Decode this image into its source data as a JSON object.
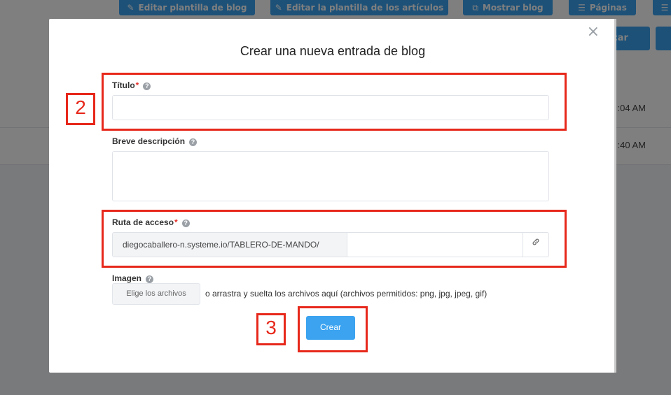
{
  "background": {
    "toolbar_buttons": [
      {
        "icon": "✎",
        "label": "Editar plantilla de blog"
      },
      {
        "icon": "✎",
        "label": "Editar la plantilla de los artículos"
      },
      {
        "icon": "⧉",
        "label": "Mostrar blog"
      },
      {
        "icon": "☰",
        "label": "Páginas"
      },
      {
        "icon": "☰",
        "label": ""
      }
    ],
    "right_button_label": "car",
    "rows": [
      {
        "time": ":04 AM"
      },
      {
        "time": ":40 AM"
      }
    ]
  },
  "modal": {
    "title": "Crear una nueva entrada de blog",
    "close_label": "×",
    "title_field": {
      "label": "Título",
      "required_mark": "*",
      "value": ""
    },
    "description_field": {
      "label": "Breve descripción",
      "value": ""
    },
    "path_field": {
      "label": "Ruta de acceso",
      "required_mark": "*",
      "prefix": "diegocaballero-n.systeme.io/TABLERO-DE-MANDO/",
      "value": ""
    },
    "image_field": {
      "label": "Imagen",
      "button_label": "Elige los archivos",
      "hint": "o arrastra y suelta los archivos aquí (archivos permitidos: png, jpg, jpeg, gif)"
    },
    "create_button_label": "Crear",
    "help_glyph": "?",
    "link_icon": "link-icon"
  },
  "annotations": [
    {
      "label": "2"
    },
    {
      "label": "3"
    }
  ],
  "colors": {
    "primary": "#3ba3f0",
    "annotation": "#e7281b",
    "required": "#e5322d"
  }
}
